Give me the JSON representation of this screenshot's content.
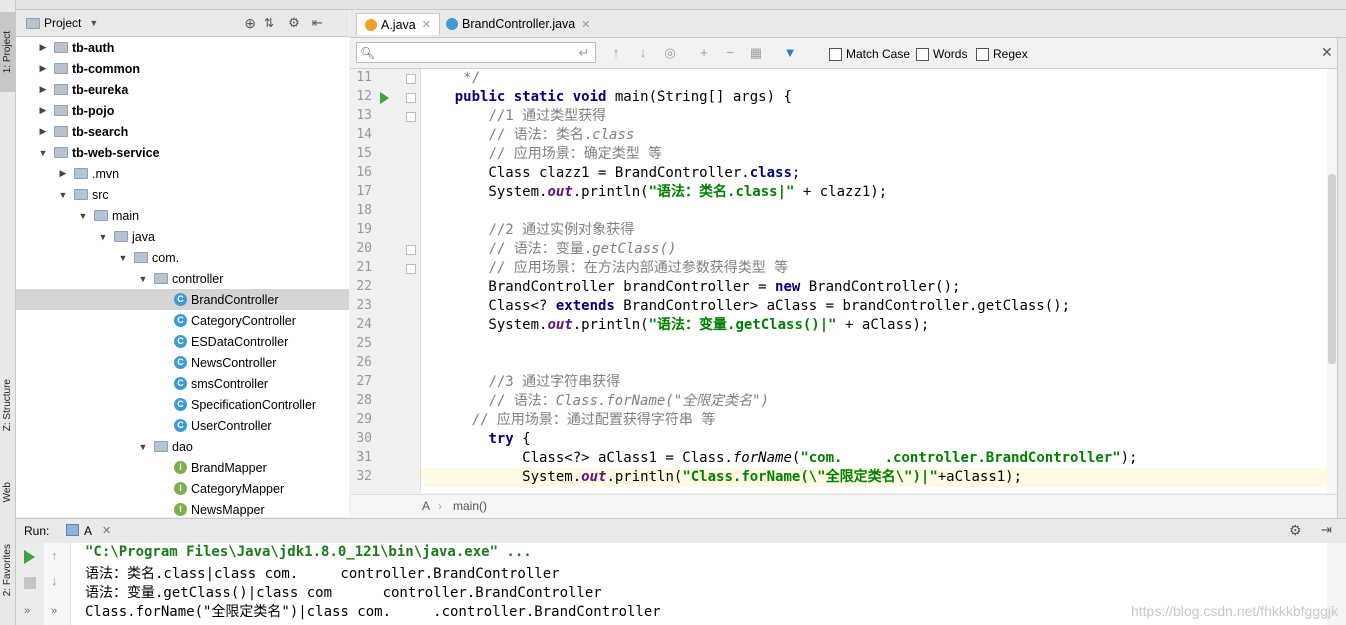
{
  "left_strip": {
    "project_tab": "1: Project",
    "structure_tab": "Z: Structure",
    "web_tab": "Web",
    "favorites_tab": "2: Favorites"
  },
  "project_panel": {
    "title": "Project",
    "tree": [
      {
        "label": "tb-auth",
        "indent": 0,
        "arrow": "right",
        "icon": "module",
        "bold": true
      },
      {
        "label": "tb-common",
        "indent": 0,
        "arrow": "right",
        "icon": "module",
        "bold": true
      },
      {
        "label": "tb-eureka",
        "indent": 0,
        "arrow": "right",
        "icon": "module",
        "bold": true
      },
      {
        "label": "tb-pojo",
        "indent": 0,
        "arrow": "right",
        "icon": "module",
        "bold": true
      },
      {
        "label": "tb-search",
        "indent": 0,
        "arrow": "right",
        "icon": "module",
        "bold": true
      },
      {
        "label": "tb-web-service",
        "indent": 0,
        "arrow": "down",
        "icon": "module",
        "bold": true
      },
      {
        "label": ".mvn",
        "indent": 1,
        "arrow": "right",
        "icon": "folder"
      },
      {
        "label": "src",
        "indent": 1,
        "arrow": "down",
        "icon": "folder"
      },
      {
        "label": "main",
        "indent": 2,
        "arrow": "down",
        "icon": "folder"
      },
      {
        "label": "java",
        "indent": 3,
        "arrow": "down",
        "icon": "folder"
      },
      {
        "label": "com.",
        "indent": 4,
        "arrow": "down",
        "icon": "folder"
      },
      {
        "label": "controller",
        "indent": 5,
        "arrow": "down",
        "icon": "folder"
      },
      {
        "label": "BrandController",
        "indent": 6,
        "arrow": "",
        "icon": "class",
        "selected": true
      },
      {
        "label": "CategoryController",
        "indent": 6,
        "arrow": "",
        "icon": "class"
      },
      {
        "label": "ESDataController",
        "indent": 6,
        "arrow": "",
        "icon": "class"
      },
      {
        "label": "NewsController",
        "indent": 6,
        "arrow": "",
        "icon": "class"
      },
      {
        "label": "smsController",
        "indent": 6,
        "arrow": "",
        "icon": "class"
      },
      {
        "label": "SpecificationController",
        "indent": 6,
        "arrow": "",
        "icon": "class"
      },
      {
        "label": "UserController",
        "indent": 6,
        "arrow": "",
        "icon": "class"
      },
      {
        "label": "dao",
        "indent": 5,
        "arrow": "down",
        "icon": "folder"
      },
      {
        "label": "BrandMapper",
        "indent": 6,
        "arrow": "",
        "icon": "interface"
      },
      {
        "label": "CategoryMapper",
        "indent": 6,
        "arrow": "",
        "icon": "interface"
      },
      {
        "label": "NewsMapper",
        "indent": 6,
        "arrow": "",
        "icon": "interface"
      }
    ]
  },
  "editor_tabs": [
    {
      "label": "A.java",
      "active": true
    },
    {
      "label": "BrandController.java",
      "active": false
    }
  ],
  "search_bar": {
    "placeholder": "",
    "match_case": "Match Case",
    "words": "Words",
    "regex": "Regex"
  },
  "code_lines": [
    {
      "n": "11",
      "html": "    <span class=\"cm\"> */</span>"
    },
    {
      "n": "12",
      "html": "    <span class=\"kw\">public static void</span> main(String[] args) {"
    },
    {
      "n": "13",
      "html": "        <span class=\"cm\">//1 通过类型获得</span>"
    },
    {
      "n": "14",
      "html": "        <span class=\"cm\">// 语法：类名.</span><span class=\"cmi\">class</span>"
    },
    {
      "n": "15",
      "html": "        <span class=\"cm\">// 应用场景：确定类型 等</span>"
    },
    {
      "n": "16",
      "html": "        Class clazz1 = BrandController.<span class=\"kw\">class</span>;"
    },
    {
      "n": "17",
      "html": "        System.<span class=\"fld\">out</span>.println(<span class=\"str\">\"语法：类名.class|\"</span> + clazz1);"
    },
    {
      "n": "18",
      "html": ""
    },
    {
      "n": "19",
      "html": "        <span class=\"cm\">//2 通过实例对象获得</span>"
    },
    {
      "n": "20",
      "html": "        <span class=\"cm\">// 语法：变量.</span><span class=\"cmi\">getClass()</span>"
    },
    {
      "n": "21",
      "html": "        <span class=\"cm\">// 应用场景：在方法内部通过参数获得类型 等</span>"
    },
    {
      "n": "22",
      "html": "        BrandController brandController = <span class=\"kw\">new</span> BrandController();"
    },
    {
      "n": "23",
      "html": "        Class&lt;? <span class=\"kw\">extends</span> BrandController&gt; aClass = brandController.getClass();"
    },
    {
      "n": "24",
      "html": "        System.<span class=\"fld\">out</span>.println(<span class=\"str\">\"语法：变量.getClass()|\"</span> + aClass);"
    },
    {
      "n": "25",
      "html": ""
    },
    {
      "n": "26",
      "html": ""
    },
    {
      "n": "27",
      "html": "        <span class=\"cm\">//3 通过字符串获得</span>"
    },
    {
      "n": "28",
      "html": "        <span class=\"cm\">// 语法：</span><span class=\"cmi\">Class.forName(\"全限定类名\")</span>"
    },
    {
      "n": "29",
      "html": "      <span class=\"cm\">// 应用场景：通过配置获得字符串 等</span>"
    },
    {
      "n": "30",
      "html": "        <span class=\"kw\">try</span> {"
    },
    {
      "n": "31",
      "html": "            Class&lt;?&gt; aClass1 = Class.<span class=\"it\">forName</span>(<span class=\"str\">\"com.     .controller.BrandController\"</span>);"
    },
    {
      "n": "32",
      "html": "            System.<span class=\"fld\">out</span>.println(<span class=\"str\">\"Class.forName(\\\"全限定类名\\\")|\"</span>+aClass1);",
      "hl": true
    }
  ],
  "breadcrumb": {
    "class_name": "A",
    "method": "main()"
  },
  "run_panel": {
    "title": "Run:",
    "config": "A",
    "lines": [
      "\"C:\\Program Files\\Java\\jdk1.8.0_121\\bin\\java.exe\" ...",
      "语法：类名.class|class com.     controller.BrandController",
      "语法：变量.getClass()|class com      controller.BrandController",
      "Class.forName(\"全限定类名\")|class com.     .controller.BrandController"
    ]
  },
  "watermark": "https://blog.csdn.net/fhkkkbfgggjk"
}
